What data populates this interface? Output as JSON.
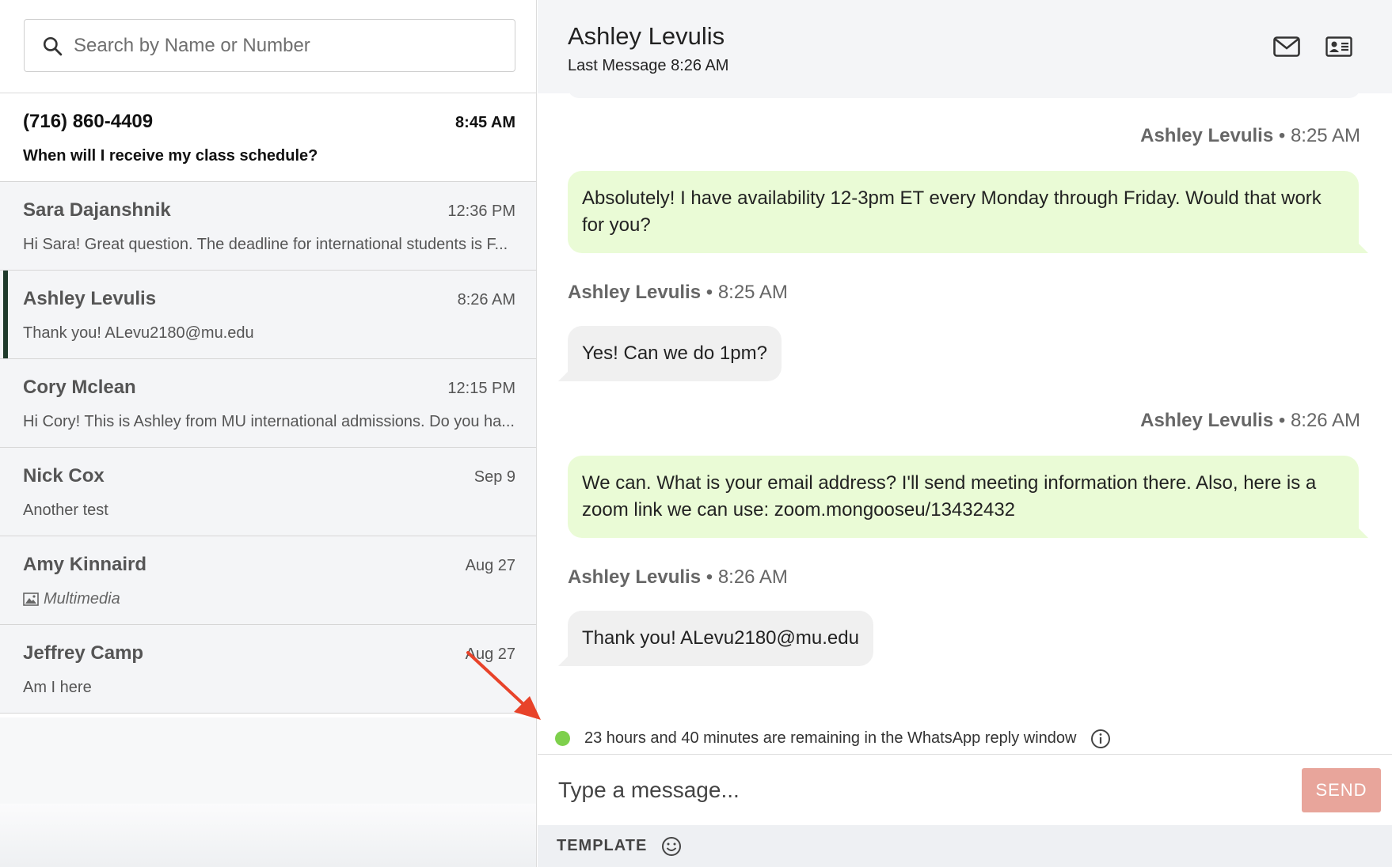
{
  "search": {
    "placeholder": "Search by Name or Number"
  },
  "conversations": [
    {
      "name": "(716) 860-4409",
      "time": "8:45 AM",
      "preview": "When will I receive my class schedule?"
    },
    {
      "name": "Sara Dajanshnik",
      "time": "12:36 PM",
      "preview": "Hi Sara! Great question. The deadline for international students is F..."
    },
    {
      "name": "Ashley Levulis",
      "time": "8:26 AM",
      "preview": "Thank you! ALevu2180@mu.edu"
    },
    {
      "name": "Cory Mclean",
      "time": "12:15 PM",
      "preview": "Hi Cory! This is Ashley from MU international admissions. Do you ha..."
    },
    {
      "name": "Nick Cox",
      "time": "Sep 9",
      "preview": "Another test"
    },
    {
      "name": "Amy Kinnaird",
      "time": "Aug 27",
      "preview": "Multimedia"
    },
    {
      "name": "Jeffrey Camp",
      "time": "Aug 27",
      "preview": "Am I here"
    }
  ],
  "header": {
    "name": "Ashley Levulis",
    "last_message": "Last Message 8:26 AM"
  },
  "messages": [
    {
      "sender": "Ashley Levulis",
      "time": "• 8:25 AM",
      "text": "Absolutely! I have availability 12-3pm ET every Monday through Friday. Would that work for you?"
    },
    {
      "sender": "Ashley Levulis",
      "time": "• 8:25 AM",
      "text": "Yes! Can we do 1pm?"
    },
    {
      "sender": "Ashley Levulis",
      "time": "• 8:26 AM",
      "text": "We can. What is your email address? I'll send meeting information there. Also, here is a zoom link we can use: zoom.mongooseu/13432432"
    },
    {
      "sender": "Ashley Levulis",
      "time": "• 8:26 AM",
      "text": "Thank you! ALevu2180@mu.edu"
    }
  ],
  "reply_window": {
    "text": "23 hours and 40 minutes are remaining in the WhatsApp reply window",
    "status_color": "#7ed04c"
  },
  "composer": {
    "placeholder": "Type a message...",
    "send_label": "SEND"
  },
  "toolbar": {
    "template_label": "TEMPLATE"
  },
  "colors": {
    "outgoing_bubble": "#eafbd6",
    "incoming_bubble": "#f0f0f0",
    "send_button": "#e8a59b",
    "active_indicator": "#1f3a2b",
    "annotation_arrow": "#e8432a"
  }
}
